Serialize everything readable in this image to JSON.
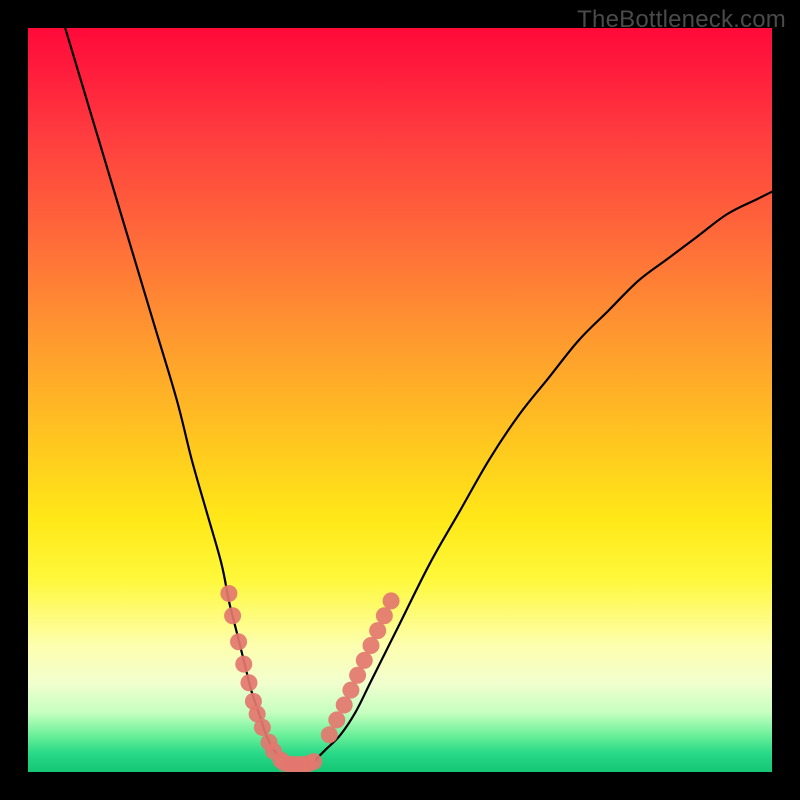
{
  "watermark": "TheBottleneck.com",
  "colors": {
    "frame": "#000000",
    "curve_stroke": "#000000",
    "marker_fill": "#e3776f",
    "gradient_stops": [
      "#ff0a3a",
      "#ff1d3c",
      "#ff3b3f",
      "#ff6a3a",
      "#ff9a2f",
      "#ffc81f",
      "#ffe818",
      "#fff83a",
      "#fdffae",
      "#f2ffce",
      "#c6ffc0",
      "#6df09a",
      "#28d987",
      "#14c774"
    ]
  },
  "chart_data": {
    "type": "line",
    "title": "",
    "xlabel": "",
    "ylabel": "",
    "xlim": [
      0,
      100
    ],
    "ylim": [
      0,
      100
    ],
    "grid": false,
    "series": [
      {
        "name": "bottleneck-curve",
        "x": [
          5,
          8,
          11,
          14,
          17,
          20,
          22,
          24,
          26,
          27,
          28,
          29,
          30,
          31,
          32,
          33,
          34,
          35,
          36,
          38,
          39,
          40,
          42,
          44,
          46,
          48,
          50,
          54,
          58,
          62,
          66,
          70,
          74,
          78,
          82,
          86,
          90,
          94,
          98,
          100
        ],
        "y": [
          100,
          90,
          80,
          70,
          60,
          50,
          42,
          35,
          28,
          23,
          19,
          15,
          11,
          8,
          5,
          3,
          2,
          1,
          1,
          1,
          2,
          3,
          5,
          8,
          12,
          16,
          20,
          28,
          35,
          42,
          48,
          53,
          58,
          62,
          66,
          69,
          72,
          75,
          77,
          78
        ]
      }
    ],
    "markers": {
      "name": "highlighted-points",
      "left_branch": {
        "x": [
          27,
          27.5,
          28.3,
          29,
          29.7,
          30.3,
          30.8,
          31.5,
          32.4,
          33,
          34
        ],
        "y": [
          24,
          21,
          17.5,
          14.5,
          12,
          9.5,
          7.8,
          6,
          4,
          2.8,
          1.6
        ]
      },
      "flat_branch": {
        "x": [
          34.5,
          35.3,
          36,
          36.8,
          37.6,
          38.4
        ],
        "y": [
          1.2,
          1,
          1,
          1,
          1.1,
          1.4
        ]
      },
      "right_branch": {
        "x": [
          40.5,
          41.5,
          42.5,
          43.4,
          44.3,
          45.2,
          46.1,
          47,
          47.9,
          48.8
        ],
        "y": [
          5,
          7,
          9,
          11,
          13,
          15,
          17,
          19,
          21,
          23
        ]
      }
    }
  }
}
